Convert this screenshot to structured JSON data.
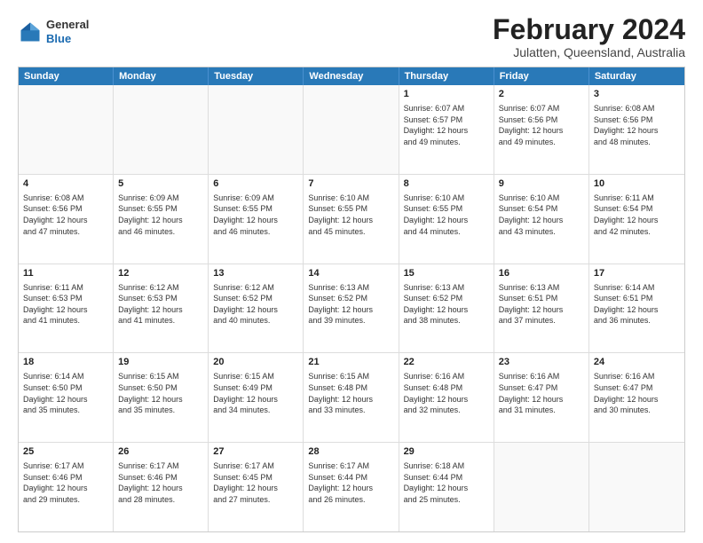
{
  "logo": {
    "general": "General",
    "blue": "Blue"
  },
  "title": "February 2024",
  "subtitle": "Julatten, Queensland, Australia",
  "headers": [
    "Sunday",
    "Monday",
    "Tuesday",
    "Wednesday",
    "Thursday",
    "Friday",
    "Saturday"
  ],
  "rows": [
    [
      {
        "day": "",
        "detail": ""
      },
      {
        "day": "",
        "detail": ""
      },
      {
        "day": "",
        "detail": ""
      },
      {
        "day": "",
        "detail": ""
      },
      {
        "day": "1",
        "detail": "Sunrise: 6:07 AM\nSunset: 6:57 PM\nDaylight: 12 hours\nand 49 minutes."
      },
      {
        "day": "2",
        "detail": "Sunrise: 6:07 AM\nSunset: 6:56 PM\nDaylight: 12 hours\nand 49 minutes."
      },
      {
        "day": "3",
        "detail": "Sunrise: 6:08 AM\nSunset: 6:56 PM\nDaylight: 12 hours\nand 48 minutes."
      }
    ],
    [
      {
        "day": "4",
        "detail": "Sunrise: 6:08 AM\nSunset: 6:56 PM\nDaylight: 12 hours\nand 47 minutes."
      },
      {
        "day": "5",
        "detail": "Sunrise: 6:09 AM\nSunset: 6:55 PM\nDaylight: 12 hours\nand 46 minutes."
      },
      {
        "day": "6",
        "detail": "Sunrise: 6:09 AM\nSunset: 6:55 PM\nDaylight: 12 hours\nand 46 minutes."
      },
      {
        "day": "7",
        "detail": "Sunrise: 6:10 AM\nSunset: 6:55 PM\nDaylight: 12 hours\nand 45 minutes."
      },
      {
        "day": "8",
        "detail": "Sunrise: 6:10 AM\nSunset: 6:55 PM\nDaylight: 12 hours\nand 44 minutes."
      },
      {
        "day": "9",
        "detail": "Sunrise: 6:10 AM\nSunset: 6:54 PM\nDaylight: 12 hours\nand 43 minutes."
      },
      {
        "day": "10",
        "detail": "Sunrise: 6:11 AM\nSunset: 6:54 PM\nDaylight: 12 hours\nand 42 minutes."
      }
    ],
    [
      {
        "day": "11",
        "detail": "Sunrise: 6:11 AM\nSunset: 6:53 PM\nDaylight: 12 hours\nand 41 minutes."
      },
      {
        "day": "12",
        "detail": "Sunrise: 6:12 AM\nSunset: 6:53 PM\nDaylight: 12 hours\nand 41 minutes."
      },
      {
        "day": "13",
        "detail": "Sunrise: 6:12 AM\nSunset: 6:52 PM\nDaylight: 12 hours\nand 40 minutes."
      },
      {
        "day": "14",
        "detail": "Sunrise: 6:13 AM\nSunset: 6:52 PM\nDaylight: 12 hours\nand 39 minutes."
      },
      {
        "day": "15",
        "detail": "Sunrise: 6:13 AM\nSunset: 6:52 PM\nDaylight: 12 hours\nand 38 minutes."
      },
      {
        "day": "16",
        "detail": "Sunrise: 6:13 AM\nSunset: 6:51 PM\nDaylight: 12 hours\nand 37 minutes."
      },
      {
        "day": "17",
        "detail": "Sunrise: 6:14 AM\nSunset: 6:51 PM\nDaylight: 12 hours\nand 36 minutes."
      }
    ],
    [
      {
        "day": "18",
        "detail": "Sunrise: 6:14 AM\nSunset: 6:50 PM\nDaylight: 12 hours\nand 35 minutes."
      },
      {
        "day": "19",
        "detail": "Sunrise: 6:15 AM\nSunset: 6:50 PM\nDaylight: 12 hours\nand 35 minutes."
      },
      {
        "day": "20",
        "detail": "Sunrise: 6:15 AM\nSunset: 6:49 PM\nDaylight: 12 hours\nand 34 minutes."
      },
      {
        "day": "21",
        "detail": "Sunrise: 6:15 AM\nSunset: 6:48 PM\nDaylight: 12 hours\nand 33 minutes."
      },
      {
        "day": "22",
        "detail": "Sunrise: 6:16 AM\nSunset: 6:48 PM\nDaylight: 12 hours\nand 32 minutes."
      },
      {
        "day": "23",
        "detail": "Sunrise: 6:16 AM\nSunset: 6:47 PM\nDaylight: 12 hours\nand 31 minutes."
      },
      {
        "day": "24",
        "detail": "Sunrise: 6:16 AM\nSunset: 6:47 PM\nDaylight: 12 hours\nand 30 minutes."
      }
    ],
    [
      {
        "day": "25",
        "detail": "Sunrise: 6:17 AM\nSunset: 6:46 PM\nDaylight: 12 hours\nand 29 minutes."
      },
      {
        "day": "26",
        "detail": "Sunrise: 6:17 AM\nSunset: 6:46 PM\nDaylight: 12 hours\nand 28 minutes."
      },
      {
        "day": "27",
        "detail": "Sunrise: 6:17 AM\nSunset: 6:45 PM\nDaylight: 12 hours\nand 27 minutes."
      },
      {
        "day": "28",
        "detail": "Sunrise: 6:17 AM\nSunset: 6:44 PM\nDaylight: 12 hours\nand 26 minutes."
      },
      {
        "day": "29",
        "detail": "Sunrise: 6:18 AM\nSunset: 6:44 PM\nDaylight: 12 hours\nand 25 minutes."
      },
      {
        "day": "",
        "detail": ""
      },
      {
        "day": "",
        "detail": ""
      }
    ]
  ]
}
